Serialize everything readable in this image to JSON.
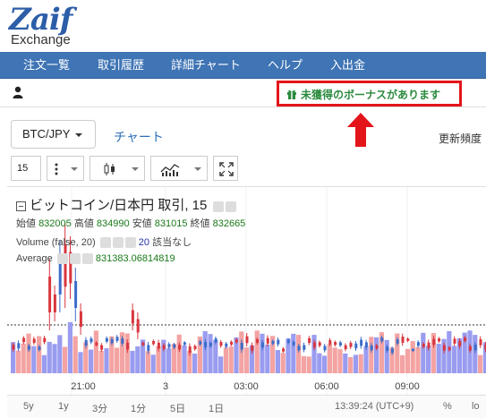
{
  "logo": {
    "mark": "Zaif",
    "sub": "Exchange"
  },
  "nav": {
    "items": [
      "注文一覧",
      "取引履歴",
      "詳細チャート",
      "ヘルプ",
      "入出金"
    ]
  },
  "userbar": {
    "bonus": "未獲得のボーナスがあります"
  },
  "controls": {
    "pair": "BTC/JPY",
    "chart_link": "チャート",
    "update_freq": "更新頻度"
  },
  "toolbar": {
    "interval": "15"
  },
  "legend": {
    "title": "ビットコイン/日本円 取引, 15",
    "open_label": "始値",
    "open": "832005",
    "high_label": "高値",
    "high": "834990",
    "low_label": "安値",
    "low": "831015",
    "close_label": "終値",
    "close": "832665",
    "volume_label": "Volume (false, 20)",
    "volume_value": "20",
    "volume_na": "該当なし",
    "average_label": "Average",
    "average_value": "831383.06814819"
  },
  "chart_data": {
    "type": "candlestick",
    "x_ticks": [
      "21:00",
      "3",
      "03:00",
      "06:00",
      "09:00"
    ],
    "up_color": "#3b6dc9",
    "down_color": "#d9363e",
    "volume_up_color": "#9a9cf0",
    "volume_down_color": "#f4a3a3"
  },
  "bottombar": {
    "ranges": [
      "5y",
      "1y",
      "3分",
      "1分",
      "5日",
      "1日"
    ],
    "clock": "13:39:24 (UTC+9)",
    "percent": "%",
    "log": "lo"
  },
  "colors": {
    "brand": "#3f74b5",
    "bonus_green": "#2b8a3e",
    "highlight_red": "#e4141b"
  }
}
